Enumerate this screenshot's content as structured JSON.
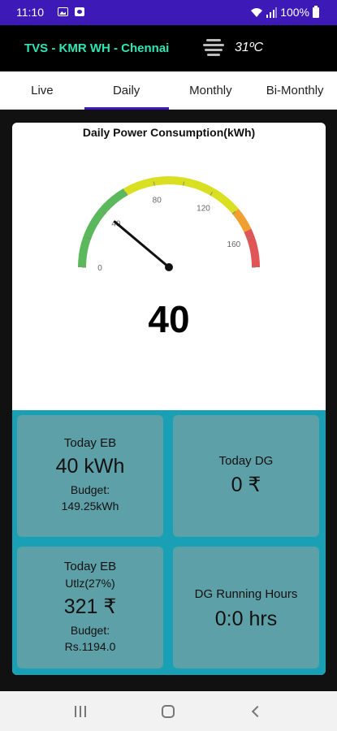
{
  "status_bar": {
    "time": "11:10",
    "battery": "100%",
    "icons": [
      "image-icon",
      "app-icon",
      "wifi-icon",
      "signal-icon",
      "battery-icon"
    ]
  },
  "header": {
    "title": "TVS - KMR WH - Chennai",
    "weather_icon": "fog-icon",
    "temperature": "31ºC",
    "title_color": "#2ee6b5"
  },
  "tabs": [
    {
      "label": "Live",
      "active": false
    },
    {
      "label": "Daily",
      "active": true
    },
    {
      "label": "Monthly",
      "active": false
    },
    {
      "label": "Bi-Monthly",
      "active": false
    }
  ],
  "gauge": {
    "title": "Daily Power Consumption(kWh)",
    "value": 40,
    "display_value": "40",
    "min": 0,
    "max": 180,
    "tick_labels": [
      "0",
      "40",
      "80",
      "120",
      "160"
    ],
    "bands": [
      {
        "from": 0,
        "to": 60,
        "color": "#5cb85c"
      },
      {
        "from": 60,
        "to": 140,
        "color": "#d9e021"
      },
      {
        "from": 140,
        "to": 155,
        "color": "#f0a030"
      },
      {
        "from": 155,
        "to": 180,
        "color": "#e05555"
      }
    ]
  },
  "tiles": {
    "today_eb": {
      "label": "Today EB",
      "value": "40 kWh",
      "budget_label": "Budget:",
      "budget_value": "149.25kWh"
    },
    "today_dg": {
      "label": "Today DG",
      "value": "0 ₹"
    },
    "today_eb_util": {
      "label": "Today EB",
      "sublabel": "Utlz(27%)",
      "value": "321 ₹",
      "budget_label": "Budget:",
      "budget_value": "Rs.1194.0"
    },
    "dg_hours": {
      "label": "DG Running Hours",
      "value": "0:0 hrs"
    }
  },
  "nav": {
    "icons": [
      "recents-icon",
      "home-icon",
      "back-icon"
    ]
  }
}
